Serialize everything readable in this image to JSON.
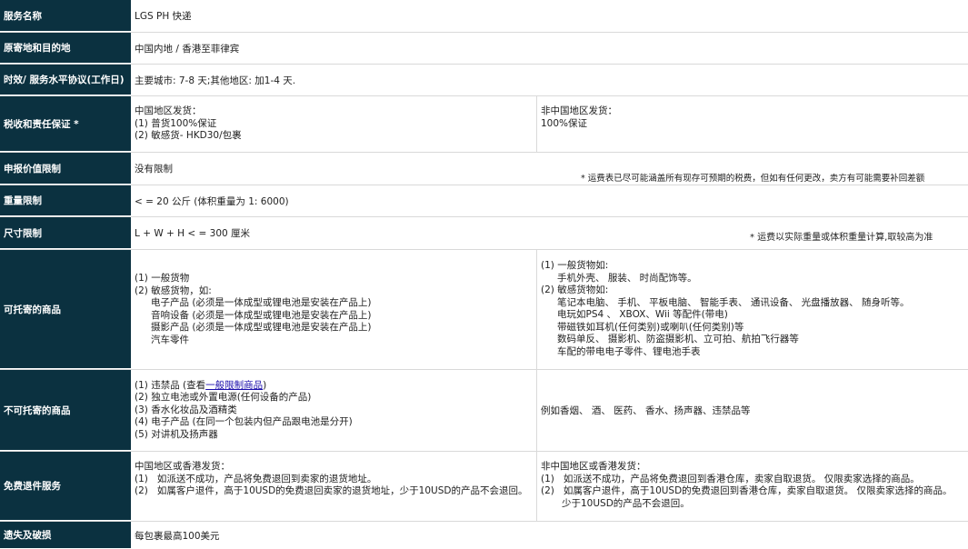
{
  "rows": {
    "service": {
      "label": "服务名称",
      "value": "LGS PH 快递"
    },
    "origin": {
      "label": "原寄地和目的地",
      "value": "中国内地 / 香港至菲律宾"
    },
    "sla": {
      "label": "时效/ 服务水平协议(工作日)",
      "value": "主要城市: 7-8 天;其他地区: 加1-4 天."
    },
    "tax": {
      "label": "税收和责任保证 *",
      "cn_title": "中国地区发货：",
      "cn_1": "(1) 普货100%保证",
      "cn_2": "(2) 敏感货- HKD30/包裹",
      "noncn_title": "非中国地区发货：",
      "noncn_1": "100%保证"
    },
    "declared": {
      "label": "申报价值限制",
      "value": "没有限制",
      "note": "* 运费表已尽可能涵盖所有现存可预期的税费，但如有任何更改，卖方有可能需要补回差额"
    },
    "weight": {
      "label": "重量限制",
      "value": "< = 20 公斤 (体积重量为 1: 6000)"
    },
    "size": {
      "label": "尺寸限制",
      "value": "L + W + H < = 300 厘米",
      "note": "* 运费以实际重量或体积重量计算,取较高为准"
    },
    "allowed": {
      "label": "可托寄的商品",
      "left": [
        "(1) 一般货物",
        "(2) 敏感货物，如:",
        "电子产品 (必须是一体成型或锂电池是安装在产品上)",
        "音响设备 (必须是一体成型或锂电池是安装在产品上)",
        "摄影产品 (必须是一体成型或锂电池是安装在产品上)",
        "汽车零件"
      ],
      "right": [
        "(1) 一般货物如:",
        "手机外壳、 服装、 时尚配饰等。",
        "(2) 敏感货物如:",
        "笔记本电脑、 手机、 平板电脑、 智能手表、 通讯设备、 光盘播放器、 随身听等。",
        "电玩如PS4 、 XBOX、Wii 等配件(带电)",
        "带磁铁如耳机(任何类别)或喇叭(任何类别)等",
        "数码单反、 摄影机、防盗摄影机、立可拍、航拍飞行器等",
        "车配的带电电子零件、锂电池手表"
      ]
    },
    "prohibited": {
      "label": "不可托寄的商品",
      "left_1_pre": "(1) 违禁品 (查看",
      "left_1_link": "一般限制商品",
      "left_1_post": ")",
      "left_2": "(2) 独立电池或外置电源(任何设备的产品)",
      "left_3": "(3) 香水化妆品及酒精类",
      "left_4": "(4) 电子产品 (在同一个包装内但产品跟电池是分开)",
      "left_5": "(5) 对讲机及扬声器",
      "right": "例如香烟、 酒、 医药、 香水、扬声器、违禁品等"
    },
    "returns": {
      "label": "免费退件服务",
      "left": [
        "中国地区或香港发货：",
        "(1)   如派送不成功，产品将免费退回到卖家的退货地址。",
        "(2)   如属客户退件，高于10USD的免费退回卖家的退货地址，少于10USD的产品不会退回。"
      ],
      "right": [
        "非中国地区或香港发货：",
        "(1)   如派送不成功，产品将免费退回到香港仓库，卖家自取退货。 仅限卖家选择的商品。",
        "(2)   如属客户退件，高于10USD的免费退回到香港仓库，卖家自取退货。 仅限卖家选择的商品。",
        "少于10USD的产品不会退回。"
      ]
    },
    "loss": {
      "label": "遗失及破损",
      "value": "每包裹最高100美元"
    }
  }
}
